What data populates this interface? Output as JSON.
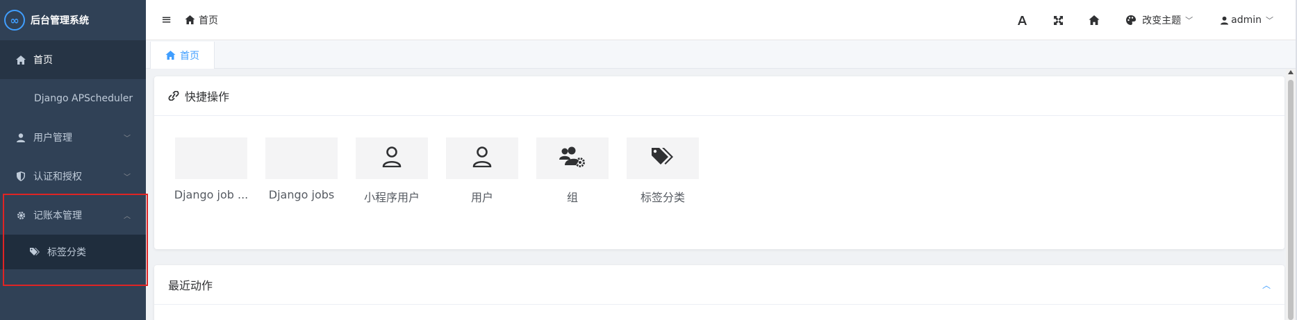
{
  "app": {
    "title": "后台管理系统"
  },
  "sidebar": {
    "items": [
      {
        "label": "首页",
        "icon": "home-icon"
      },
      {
        "label": "Django APScheduler"
      },
      {
        "label": "用户管理",
        "icon": "user-icon",
        "expandable": true
      },
      {
        "label": "认证和授权",
        "icon": "shield-icon",
        "expandable": true
      },
      {
        "label": "记账本管理",
        "icon": "gear-icon",
        "expandable": true,
        "expanded": true
      }
    ],
    "submenu": [
      {
        "label": "标签分类",
        "icon": "tags-icon"
      }
    ]
  },
  "header": {
    "breadcrumb": "首页",
    "theme_label": "改变主题",
    "user_label": "admin"
  },
  "tabs": [
    {
      "label": "首页",
      "active": true
    }
  ],
  "quick_ops": {
    "title": "快捷操作",
    "items": [
      {
        "label": "Django job ...",
        "icon": ""
      },
      {
        "label": "Django jobs",
        "icon": ""
      },
      {
        "label": "小程序用户",
        "icon": "user-outline-icon"
      },
      {
        "label": "用户",
        "icon": "user-outline-icon"
      },
      {
        "label": "组",
        "icon": "users-cog-icon"
      },
      {
        "label": "标签分类",
        "icon": "tags-icon"
      }
    ]
  },
  "recent": {
    "title": "最近动作"
  },
  "colors": {
    "sidebar_bg": "#304156",
    "accent": "#409eff",
    "highlight_border": "#e02424"
  }
}
